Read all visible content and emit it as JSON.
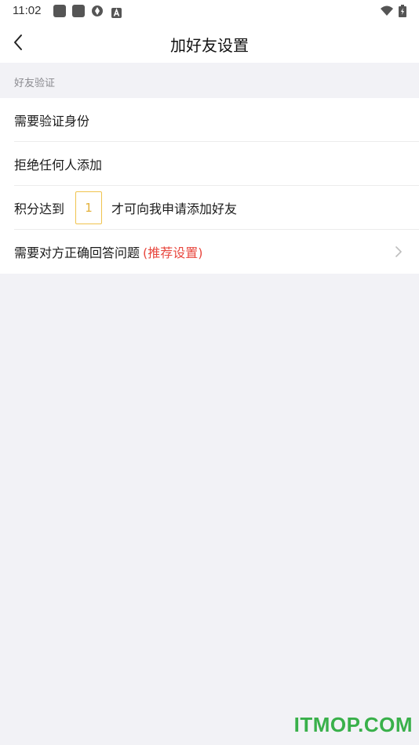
{
  "status_bar": {
    "time": "11:02",
    "icons": [
      "app-square-icon",
      "app-square-icon",
      "aperture-icon",
      "a-badge-icon",
      "wifi-icon",
      "battery-charging-icon"
    ]
  },
  "header": {
    "title": "加好友设置",
    "back_icon": "chevron-left-icon"
  },
  "section": {
    "label": "好友验证"
  },
  "options": {
    "verify_identity": "需要验证身份",
    "reject_all": "拒绝任何人添加",
    "score_prefix": "积分达到",
    "score_value": "1",
    "score_suffix": "才可向我申请添加好友",
    "answer_question": "需要对方正确回答问题",
    "answer_recommend": "(推荐设置)"
  },
  "colors": {
    "accent_yellow": "#f0c34e",
    "recommend_red": "#e8473e",
    "background": "#f2f2f6",
    "watermark_green": "#39b04a"
  },
  "watermark": "ITMOP.COM"
}
